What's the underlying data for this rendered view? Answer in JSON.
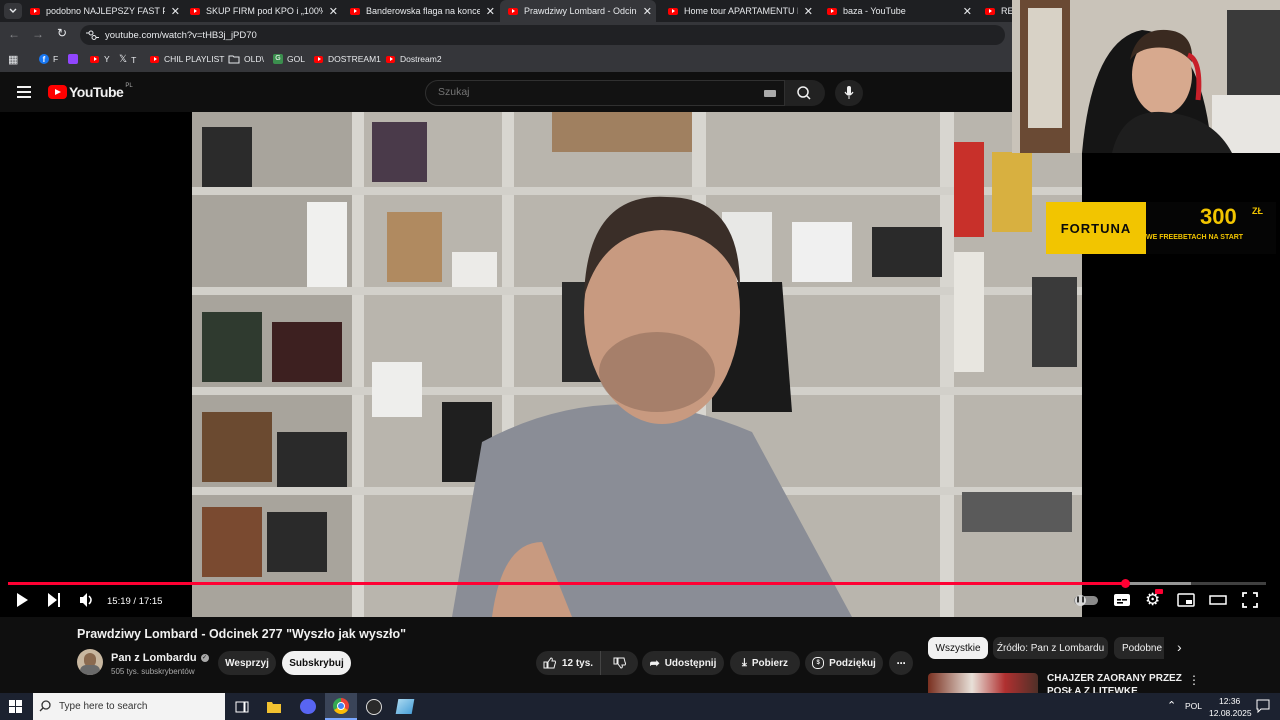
{
  "browser": {
    "tabs": [
      {
        "title": "podobno NAJLEPSZY FAST FOO",
        "active": false
      },
      {
        "title": "SKUP FIRM pod KPO i „100% W",
        "active": false
      },
      {
        "title": "Banderowska flaga na koncerc",
        "active": false
      },
      {
        "title": "Prawdziwy Lombard - Odcinek",
        "active": true
      },
      {
        "title": "Home tour APARTAMENTU PR",
        "active": false
      },
      {
        "title": "baza - YouTube",
        "active": false
      },
      {
        "title": "RE",
        "active": false
      }
    ],
    "url": "youtube.com/watch?v=tHB3j_jPD70",
    "bookmarks": [
      "F",
      "",
      "Y",
      "T",
      "CHIL PLAYLIST",
      "OLD\\",
      "GOL",
      "DOSTREAM1",
      "Dostream2"
    ]
  },
  "youtube": {
    "logo_text": "YouTube",
    "logo_region": "PL",
    "search_placeholder": "Szukaj"
  },
  "player": {
    "time": "15:19 / 17:15",
    "progress": 0.888,
    "buffered": 0.94,
    "ad_brand": "FORTUNA",
    "ad_amount": "300",
    "ad_currency": "ZŁ",
    "ad_tagline": "WE FREEBETACH NA START",
    "colors": {
      "progress": "#ff0033",
      "ad_yellow": "#f2c500"
    }
  },
  "video_info": {
    "title": "Prawdziwy Lombard - Odcinek 277 \"Wyszło jak wyszło\"",
    "channel": "Pan z Lombardu",
    "subscribers": "505 tys. subskrybentów",
    "support_label": "Wesprzyj",
    "subscribe_label": "Subskrybuj",
    "likes": "12 tys.",
    "share_label": "Udostępnij",
    "download_label": "Pobierz",
    "thanks_label": "Podziękuj"
  },
  "chips": [
    "Wszystkie",
    "Źródło: Pan z Lombardu",
    "Podobne"
  ],
  "suggestion": {
    "title": "CHAJZER ZAORANY PRZEZ",
    "title2": "POSŁA Z LITEWKE"
  },
  "taskbar": {
    "search_placeholder": "Type here to search",
    "language": "POL",
    "time": "12:36",
    "date": "12.08.2025"
  }
}
